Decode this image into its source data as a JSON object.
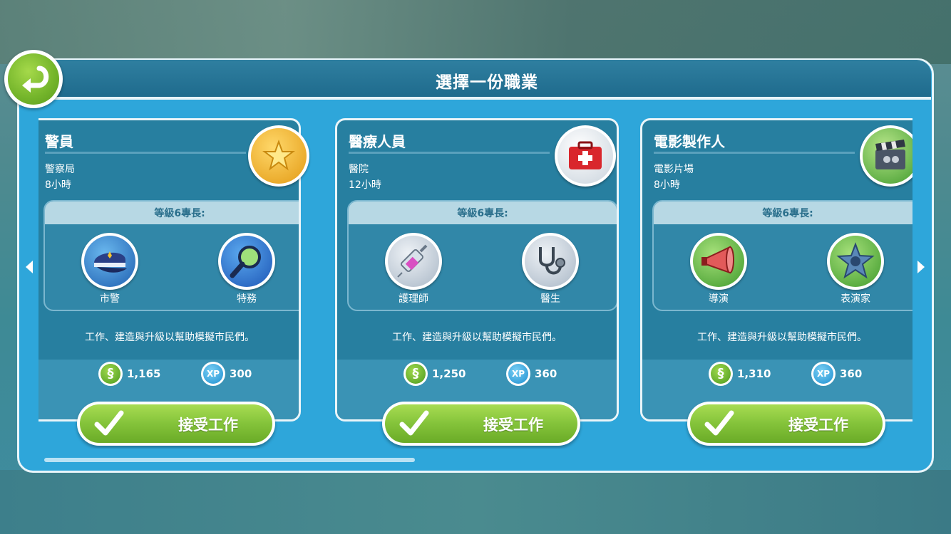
{
  "header": {
    "title": "選擇一份職業"
  },
  "colors": {
    "panel": "#2ea6da",
    "card": "#277fa0",
    "accept_green": "#84c33a",
    "xp_blue": "#1e8fd0"
  },
  "spec_header": "等級6專長:",
  "cards": [
    {
      "name": "警員",
      "workplace": "警察局",
      "hours": "8小時",
      "emblem_icon": "police-badge-icon",
      "specialties": [
        {
          "label": "市警",
          "icon": "police-cap-icon"
        },
        {
          "label": "特務",
          "icon": "magnifier-icon"
        }
      ],
      "description": "工作、建造與升級以幫助模擬市民們。",
      "simoleons": "1,165",
      "xp": "300",
      "accept_label": "接受工作"
    },
    {
      "name": "醫療人員",
      "workplace": "醫院",
      "hours": "12小時",
      "emblem_icon": "first-aid-kit-icon",
      "specialties": [
        {
          "label": "護理師",
          "icon": "syringe-icon"
        },
        {
          "label": "醫生",
          "icon": "stethoscope-icon"
        }
      ],
      "description": "工作、建造與升級以幫助模擬市民們。",
      "simoleons": "1,250",
      "xp": "360",
      "accept_label": "接受工作"
    },
    {
      "name": "電影製作人",
      "workplace": "電影片場",
      "hours": "8小時",
      "emblem_icon": "clapperboard-icon",
      "specialties": [
        {
          "label": "導演",
          "icon": "megaphone-icon"
        },
        {
          "label": "表演家",
          "icon": "star-icon"
        }
      ],
      "description": "工作、建造與升級以幫助模擬市民們。",
      "simoleons": "1,310",
      "xp": "360",
      "accept_label": "接受工作"
    }
  ],
  "xp_badge": "XP",
  "simoleon_badge": "§"
}
